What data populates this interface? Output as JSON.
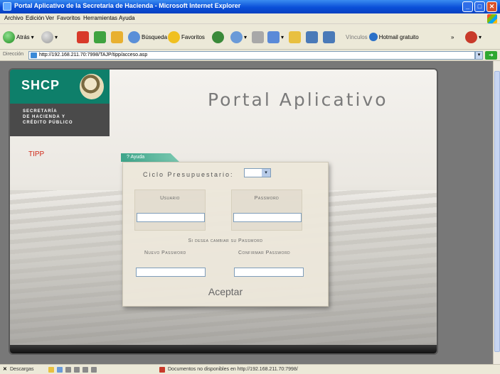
{
  "window": {
    "title": "Portal Aplicativo de la Secretaria de Hacienda - Microsoft Internet Explorer",
    "min_label": "_",
    "max_label": "□",
    "close_label": "✕"
  },
  "menu": [
    "Archivo",
    "Edición",
    "Ver",
    "Favoritos",
    "Herramientas",
    "Ayuda"
  ],
  "toolbar": {
    "back_label": "Atrás",
    "search_label": "Búsqueda",
    "favorites_label": "Favoritos",
    "vinculos_label": "Vínculos",
    "hotmail_label": "Hotmail gratuito"
  },
  "address": {
    "label": "Dirección",
    "url": "http://192.168.211.70:7998/TAJP/tipp/acceso.asp"
  },
  "page": {
    "logo": "SHCP",
    "dept_line1": "SECRETARÍA",
    "dept_line2": "DE HACIENDA Y",
    "dept_line3": "CRÉDITO PÚBLICO",
    "portal_title": "Portal Aplicativo",
    "tipp": "TIPP",
    "help_tab": "? Ayuda"
  },
  "form": {
    "ciclo_label": "Ciclo Presupuestario:",
    "ciclo_value": "",
    "usuario_label": "Usuario",
    "password_label": "Password",
    "cambiar_label": "Si desea cambiar su Password",
    "nuevo_password_label": "Nuevo Password",
    "confirmar_password_label": "Confirmar Password",
    "aceptar_label": "Aceptar"
  },
  "status": {
    "descargas_label": "Descargas",
    "message": "Documentos no disponibles en http://192.168.211.70:7998/"
  },
  "colors": {
    "shcp_green": "#0e7f6a",
    "tipp_red": "#d02a1a",
    "xp_blue": "#0a4fd8"
  }
}
